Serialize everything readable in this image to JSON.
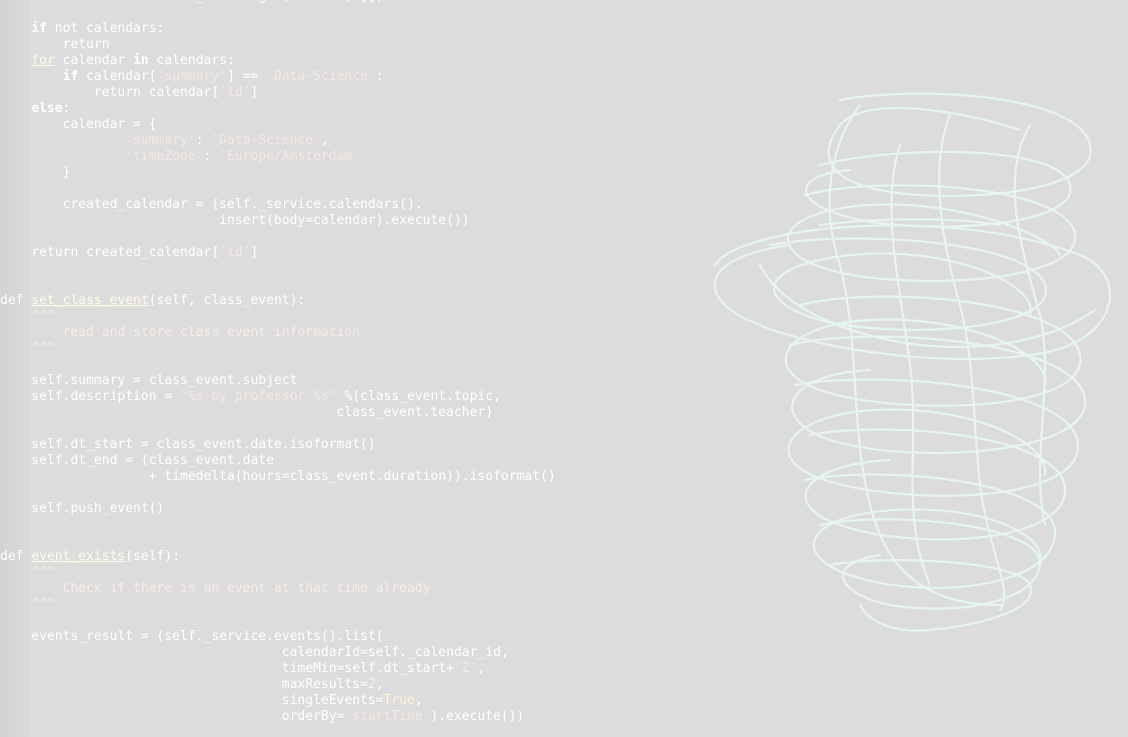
{
  "colors": {
    "background": "#dcdcdc",
    "code_text": "#ffffff",
    "string": "#f4e8e4",
    "scribble": "#e6f4f2"
  },
  "icons": [
    "scribble-drawing-icon"
  ],
  "editor": {
    "lines": [
      [
        {
          "t": "    calendars = calendars_result.get("
        },
        {
          "t": "'items'",
          "c": "str"
        },
        {
          "t": ", [])"
        }
      ],
      [
        {
          "t": ""
        }
      ],
      [
        {
          "t": "    "
        },
        {
          "t": "if",
          "c": "kw"
        },
        {
          "t": " not calendars:"
        }
      ],
      [
        {
          "t": "        "
        },
        {
          "t": "return",
          "c": "kw2"
        }
      ],
      [
        {
          "t": "    "
        },
        {
          "t": "for",
          "c": "fn"
        },
        {
          "t": " calendar "
        },
        {
          "t": "in",
          "c": "kw"
        },
        {
          "t": " calendars:"
        }
      ],
      [
        {
          "t": "        "
        },
        {
          "t": "if",
          "c": "kw"
        },
        {
          "t": " calendar["
        },
        {
          "t": "'summary'",
          "c": "str"
        },
        {
          "t": "] == "
        },
        {
          "t": "'Data-Science'",
          "c": "str"
        },
        {
          "t": ":"
        }
      ],
      [
        {
          "t": "            "
        },
        {
          "t": "return",
          "c": "kw2"
        },
        {
          "t": " calendar["
        },
        {
          "t": "'id'",
          "c": "str"
        },
        {
          "t": "]"
        }
      ],
      [
        {
          "t": "    "
        },
        {
          "t": "else",
          "c": "kw"
        },
        {
          "t": ":"
        }
      ],
      [
        {
          "t": "        calendar = {"
        }
      ],
      [
        {
          "t": "                "
        },
        {
          "t": "'summary'",
          "c": "str"
        },
        {
          "t": ": "
        },
        {
          "t": "'Data-Science'",
          "c": "str"
        },
        {
          "t": ","
        }
      ],
      [
        {
          "t": "                "
        },
        {
          "t": "'timeZone'",
          "c": "str"
        },
        {
          "t": ": "
        },
        {
          "t": "'Europe/Amsterdam'",
          "c": "str"
        }
      ],
      [
        {
          "t": "        }"
        }
      ],
      [
        {
          "t": ""
        }
      ],
      [
        {
          "t": "        created_calendar = (self._service.calendars()."
        }
      ],
      [
        {
          "t": "                            insert(body=calendar).execute())"
        }
      ],
      [
        {
          "t": ""
        }
      ],
      [
        {
          "t": "    "
        },
        {
          "t": "return",
          "c": "kw2"
        },
        {
          "t": " created_calendar["
        },
        {
          "t": "'id'",
          "c": "str"
        },
        {
          "t": "]"
        }
      ],
      [
        {
          "t": ""
        }
      ],
      [
        {
          "t": ""
        }
      ],
      [
        {
          "t": "def",
          "c": "kw2"
        },
        {
          "t": " "
        },
        {
          "t": "set_class_event",
          "c": "fn"
        },
        {
          "t": "(self, class_event):"
        }
      ],
      [
        {
          "t": "    "
        },
        {
          "t": "\"\"\"",
          "c": "doc"
        }
      ],
      [
        {
          "t": "        "
        },
        {
          "t": "read and store class event information",
          "c": "doc"
        }
      ],
      [
        {
          "t": "    "
        },
        {
          "t": "\"\"\"",
          "c": "doc"
        }
      ],
      [
        {
          "t": ""
        }
      ],
      [
        {
          "t": "    self.summary = class_event.subject"
        }
      ],
      [
        {
          "t": "    self.description = "
        },
        {
          "t": "\"%s by professor %s\"",
          "c": "str"
        },
        {
          "t": " %(class_event.topic,"
        }
      ],
      [
        {
          "t": "                                           class_event.teacher)"
        }
      ],
      [
        {
          "t": ""
        }
      ],
      [
        {
          "t": "    self.dt_start = class_event.date.isoformat()"
        }
      ],
      [
        {
          "t": "    self.dt_end = (class_event.date"
        }
      ],
      [
        {
          "t": "                   + timedelta(hours=class_event.duration)).isoformat()"
        }
      ],
      [
        {
          "t": ""
        }
      ],
      [
        {
          "t": "    self.push_event()"
        }
      ],
      [
        {
          "t": ""
        }
      ],
      [
        {
          "t": ""
        }
      ],
      [
        {
          "t": "def",
          "c": "kw2"
        },
        {
          "t": " "
        },
        {
          "t": "event_exists",
          "c": "fn"
        },
        {
          "t": "(self):"
        }
      ],
      [
        {
          "t": "    "
        },
        {
          "t": "\"\"\"",
          "c": "doc"
        }
      ],
      [
        {
          "t": "        "
        },
        {
          "t": "Check if there is an event at that time already",
          "c": "doc"
        }
      ],
      [
        {
          "t": "    "
        },
        {
          "t": "\"\"\"",
          "c": "doc"
        }
      ],
      [
        {
          "t": ""
        }
      ],
      [
        {
          "t": "    events_result = (self._service.events().list("
        }
      ],
      [
        {
          "t": "                                    calendarId=self._calendar_id,"
        }
      ],
      [
        {
          "t": "                                    timeMin=self.dt_start+"
        },
        {
          "t": "'Z'",
          "c": "str"
        },
        {
          "t": ","
        }
      ],
      [
        {
          "t": "                                    maxResults="
        },
        {
          "t": "2",
          "c": "num"
        },
        {
          "t": ","
        }
      ],
      [
        {
          "t": "                                    singleEvents="
        },
        {
          "t": "True",
          "c": "bool"
        },
        {
          "t": ","
        }
      ],
      [
        {
          "t": "                                    orderBy="
        },
        {
          "t": "'startTime'",
          "c": "str"
        },
        {
          "t": ").execute())"
        }
      ]
    ]
  }
}
